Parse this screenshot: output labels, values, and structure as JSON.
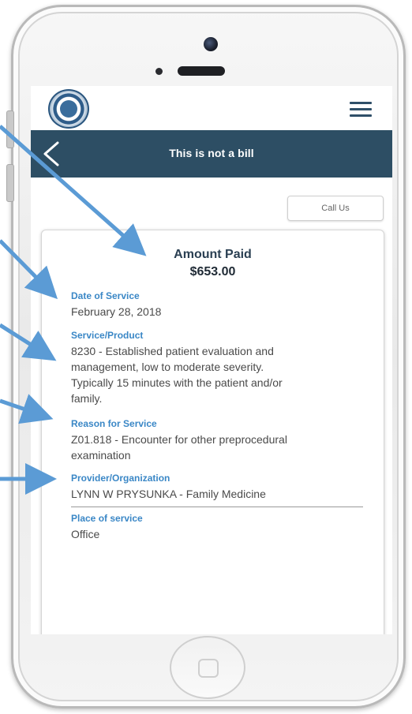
{
  "navbar": {
    "title": "This is not a bill"
  },
  "actions": {
    "call_label": "Call Us"
  },
  "summary": {
    "amount_label": "Amount Paid",
    "amount_value": "$653.00"
  },
  "fields": {
    "date_of_service": {
      "label": "Date of Service",
      "value": "February 28, 2018"
    },
    "service_product": {
      "label": "Service/Product",
      "line1": "8230 - Established patient evaluation and",
      "line2": "management, low to moderate severity.",
      "line3": "Typically 15 minutes with the patient and/or",
      "line4": "family."
    },
    "reason_for_service": {
      "label": "Reason for Service",
      "line1": "Z01.818 - Encounter for other preprocedural",
      "line2": "examination"
    },
    "provider": {
      "label": "Provider/Organization",
      "value": "LYNN W PRYSUNKA - Family Medicine"
    },
    "place_of_service": {
      "label": "Place of service",
      "value": "Office"
    }
  },
  "icons": {
    "menu": "hamburger-menu-icon",
    "back": "chevron-left-icon",
    "logo": "seal-logo-icon"
  },
  "colors": {
    "navbar": "#2d4e64",
    "label_blue": "#3a87c6",
    "arrow_blue": "#5b9bd5"
  }
}
